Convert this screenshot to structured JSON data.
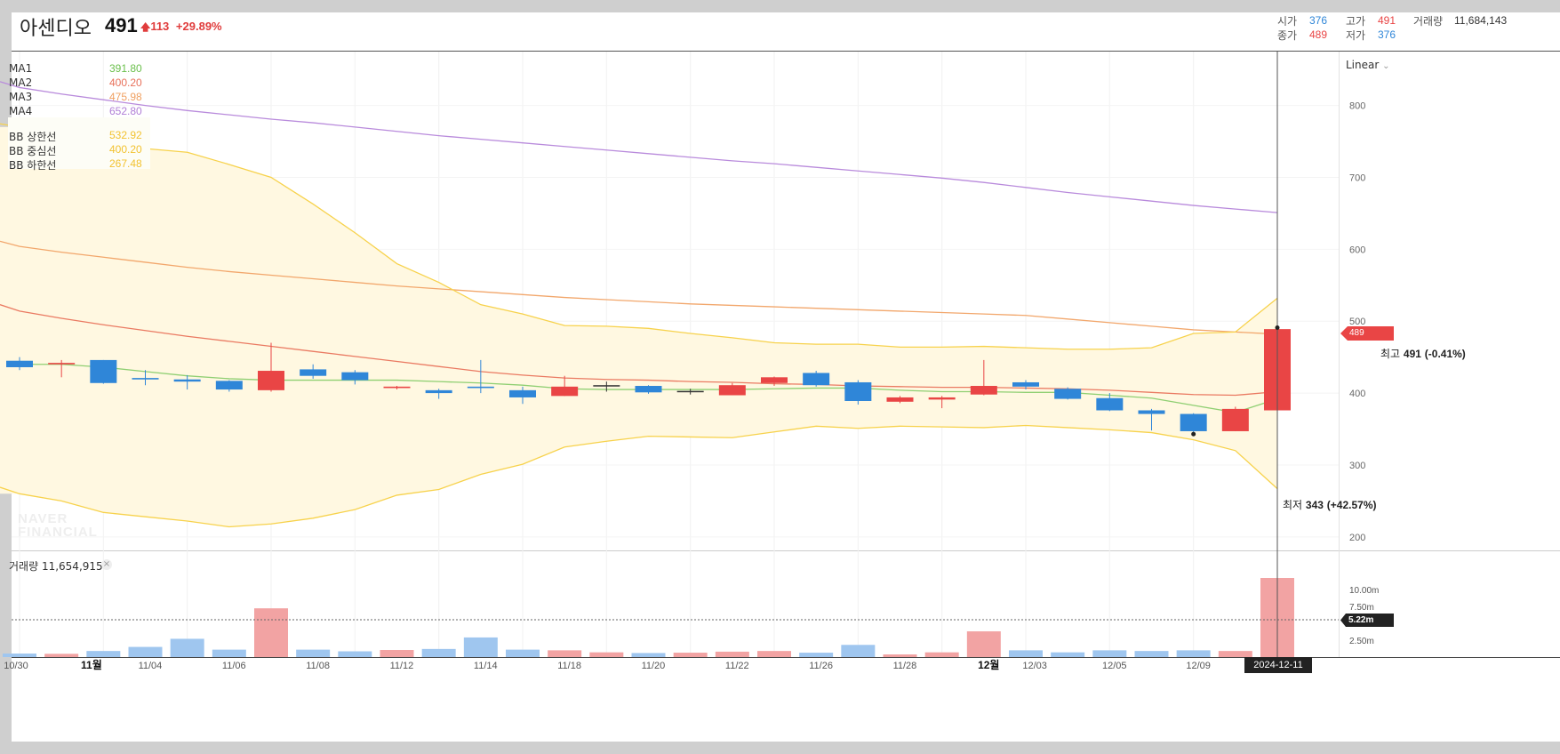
{
  "header": {
    "stock_name": "아센디오",
    "price": "491",
    "change": "113",
    "change_pct": "+29.89%",
    "stats": {
      "open_label": "시가",
      "open": "376",
      "high_label": "고가",
      "high": "491",
      "volume_label": "거래량",
      "volume": "11,684,143",
      "close_label": "종가",
      "close": "489",
      "low_label": "저가",
      "low": "376"
    }
  },
  "legend": [
    {
      "name": "MA1",
      "value": "391.80",
      "color": "#6abf4b"
    },
    {
      "name": "MA2",
      "value": "400.20",
      "color": "#e8705a"
    },
    {
      "name": "MA3",
      "value": "475.98",
      "color": "#f0a060"
    },
    {
      "name": "MA4",
      "value": "652.80",
      "color": "#b07ed6"
    },
    {
      "name": "BB 상한선",
      "value": "532.92",
      "color": "#f2c230"
    },
    {
      "name": "BB 중심선",
      "value": "400.20",
      "color": "#f2c230"
    },
    {
      "name": "BB 하한선",
      "value": "267.48",
      "color": "#f2c230"
    }
  ],
  "scale_mode": "Linear",
  "current_price_tag": "489",
  "volume_panel": {
    "title": "거래량",
    "value": "11,654,915",
    "close_icon": "close-icon",
    "current_tag": "5.22m"
  },
  "crosshair_date": "2024-12-11",
  "annotations": {
    "high": {
      "label": "최고",
      "value": "491",
      "pct": "(-0.41%)"
    },
    "low": {
      "label": "최저",
      "value": "343",
      "pct": "(+42.57%)"
    }
  },
  "watermark": [
    "NAVER",
    "FINANCIAL"
  ],
  "colors": {
    "up": "#e94545",
    "down": "#2f86d8",
    "vol_up": "#f2a3a3",
    "vol_down": "#9fc6ef",
    "bb_fill": "#fff8e1",
    "bb_line": "#f7d24c"
  },
  "chart_data": {
    "type": "candlestick",
    "x_labels": [
      "10/30",
      "11월",
      "11/04",
      "11/06",
      "11/08",
      "11/12",
      "11/14",
      "11/18",
      "11/20",
      "11/22",
      "11/26",
      "11/28",
      "12월",
      "12/03",
      "12/05",
      "12/09"
    ],
    "y_axis": {
      "ticks": [
        200,
        300,
        400,
        500,
        600,
        700,
        800
      ],
      "range": [
        180,
        875
      ]
    },
    "volume_axis": {
      "ticks": [
        "2.50m",
        "7.50m",
        "10.00m"
      ],
      "range": [
        0,
        12500000
      ]
    },
    "candles": [
      {
        "o": 445,
        "h": 450,
        "l": 432,
        "c": 436,
        "v": 520000
      },
      {
        "o": 440,
        "h": 446,
        "l": 422,
        "c": 442,
        "v": 480000
      },
      {
        "o": 446,
        "h": 446,
        "l": 413,
        "c": 414,
        "v": 900000
      },
      {
        "o": 421,
        "h": 432,
        "l": 411,
        "c": 419,
        "v": 1500000
      },
      {
        "o": 419,
        "h": 425,
        "l": 405,
        "c": 416,
        "v": 2700000
      },
      {
        "o": 417,
        "h": 418,
        "l": 402,
        "c": 405,
        "v": 1100000
      },
      {
        "o": 404,
        "h": 470,
        "l": 402,
        "c": 431,
        "v": 7200000
      },
      {
        "o": 433,
        "h": 440,
        "l": 420,
        "c": 424,
        "v": 1100000
      },
      {
        "o": 429,
        "h": 432,
        "l": 412,
        "c": 418,
        "v": 850000
      },
      {
        "o": 407,
        "h": 410,
        "l": 405,
        "c": 409,
        "v": 1050000
      },
      {
        "o": 404,
        "h": 406,
        "l": 392,
        "c": 400,
        "v": 1200000
      },
      {
        "o": 409,
        "h": 446,
        "l": 400,
        "c": 407,
        "v": 2900000
      },
      {
        "o": 404,
        "h": 409,
        "l": 385,
        "c": 394,
        "v": 1100000
      },
      {
        "o": 396,
        "h": 424,
        "l": 396,
        "c": 409,
        "v": 1000000
      },
      {
        "o": 410,
        "h": 416,
        "l": 402,
        "c": 411,
        "v": 700000
      },
      {
        "o": 410,
        "h": 411,
        "l": 399,
        "c": 401,
        "v": 600000
      },
      {
        "o": 402,
        "h": 406,
        "l": 398,
        "c": 403,
        "v": 650000
      },
      {
        "o": 397,
        "h": 414,
        "l": 397,
        "c": 411,
        "v": 800000
      },
      {
        "o": 414,
        "h": 423,
        "l": 410,
        "c": 422,
        "v": 900000
      },
      {
        "o": 428,
        "h": 431,
        "l": 409,
        "c": 411,
        "v": 650000
      },
      {
        "o": 415,
        "h": 418,
        "l": 384,
        "c": 389,
        "v": 1800000
      },
      {
        "o": 388,
        "h": 396,
        "l": 386,
        "c": 394,
        "v": 300000
      },
      {
        "o": 391,
        "h": 396,
        "l": 379,
        "c": 394,
        "v": 700000
      },
      {
        "o": 398,
        "h": 446,
        "l": 397,
        "c": 410,
        "v": 3800000
      },
      {
        "o": 415,
        "h": 418,
        "l": 405,
        "c": 409,
        "v": 1000000
      },
      {
        "o": 406,
        "h": 408,
        "l": 391,
        "c": 392,
        "v": 700000
      },
      {
        "o": 393,
        "h": 400,
        "l": 375,
        "c": 376,
        "v": 1000000
      },
      {
        "o": 376,
        "h": 378,
        "l": 348,
        "c": 371,
        "v": 900000
      },
      {
        "o": 371,
        "h": 372,
        "l": 343,
        "c": 347,
        "v": 1000000
      },
      {
        "o": 347,
        "h": 381,
        "l": 347,
        "c": 378,
        "v": 900000
      },
      {
        "o": 376,
        "h": 491,
        "l": 376,
        "c": 489,
        "v": 11684143
      }
    ],
    "series": [
      {
        "name": "MA1",
        "color": "#8fcf72",
        "values": [
          440,
          440,
          436,
          430,
          424,
          420,
          418,
          418,
          418,
          418,
          416,
          414,
          411,
          406,
          405,
          405,
          405,
          405,
          406,
          407,
          407,
          404,
          402,
          402,
          401,
          401,
          397,
          393,
          383,
          373,
          392
        ]
      },
      {
        "name": "MA2",
        "color": "#ea7a62",
        "values": [
          514,
          504,
          495,
          487,
          479,
          472,
          465,
          458,
          451,
          444,
          437,
          430,
          425,
          421,
          419,
          418,
          416,
          415,
          413,
          412,
          410,
          409,
          408,
          408,
          407,
          406,
          404,
          401,
          398,
          397,
          402
        ]
      },
      {
        "name": "MA3",
        "color": "#f2a76c",
        "values": [
          604,
          596,
          589,
          582,
          575,
          569,
          564,
          559,
          554,
          549,
          545,
          541,
          537,
          533,
          530,
          527,
          524,
          522,
          520,
          518,
          516,
          514,
          512,
          510,
          508,
          503,
          498,
          493,
          488,
          485,
          482
        ]
      },
      {
        "name": "MA4",
        "color": "#b98bdc",
        "values": [
          825,
          816,
          808,
          800,
          793,
          787,
          781,
          776,
          770,
          764,
          758,
          753,
          748,
          743,
          738,
          733,
          728,
          723,
          719,
          714,
          709,
          704,
          699,
          693,
          686,
          679,
          673,
          667,
          661,
          656,
          651
        ]
      },
      {
        "name": "BB 상한선",
        "color": "#f7d24c",
        "values": [
          770,
          765,
          755,
          740,
          735,
          718,
          700,
          663,
          623,
          580,
          554,
          523,
          510,
          494,
          493,
          490,
          483,
          477,
          470,
          468,
          468,
          464,
          464,
          465,
          463,
          461,
          461,
          463,
          483,
          485,
          532
        ]
      },
      {
        "name": "BB 하한선",
        "color": "#f7d24c",
        "values": [
          260,
          250,
          234,
          228,
          222,
          214,
          218,
          226,
          238,
          258,
          266,
          287,
          301,
          325,
          333,
          340,
          339,
          338,
          346,
          354,
          351,
          354,
          353,
          352,
          355,
          352,
          349,
          345,
          335,
          320,
          267
        ]
      }
    ]
  }
}
